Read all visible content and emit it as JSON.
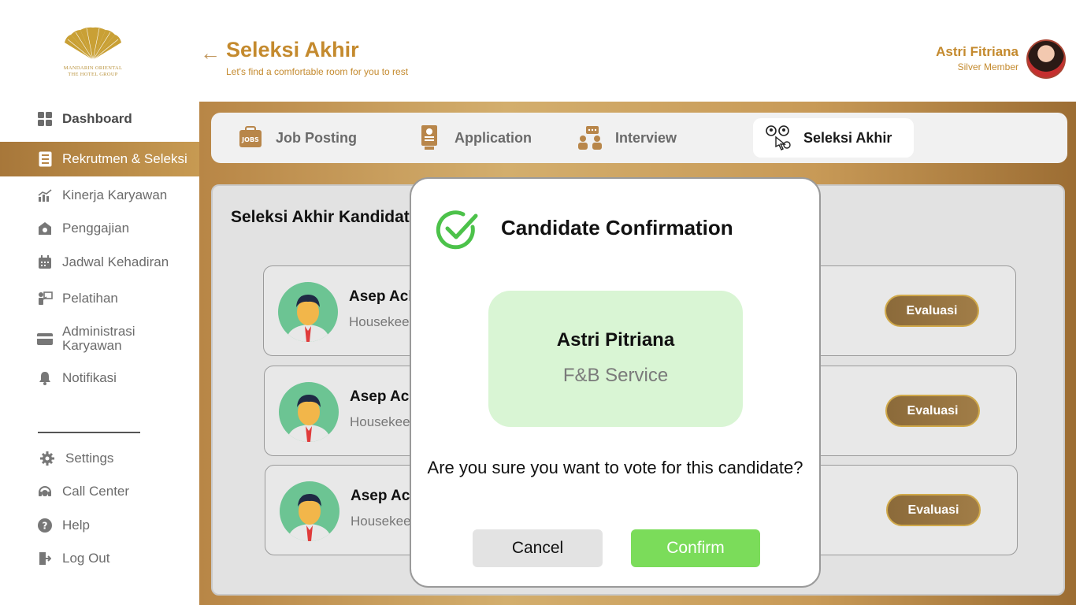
{
  "brand": {
    "logo_line1": "MANDARIN ORIENTAL",
    "logo_line2": "THE HOTEL GROUP"
  },
  "sidebar": {
    "items": [
      {
        "label": "Dashboard",
        "icon": "dashboard-icon"
      },
      {
        "label": "Rekrutmen & Seleksi",
        "icon": "document-list-icon",
        "active": true
      },
      {
        "label": "Kinerja Karyawan",
        "icon": "performance-chart-icon"
      },
      {
        "label": "Penggajian",
        "icon": "payroll-icon"
      },
      {
        "label": "Jadwal Kehadiran",
        "icon": "calendar-icon"
      },
      {
        "label": "Pelatihan",
        "icon": "training-icon"
      },
      {
        "label": "Administrasi Karyawan",
        "icon": "card-icon"
      },
      {
        "label": "Notifikasi",
        "icon": "bell-icon"
      }
    ],
    "bottom_items": [
      {
        "label": "Settings",
        "icon": "gear-icon"
      },
      {
        "label": "Call Center",
        "icon": "headset-icon"
      },
      {
        "label": "Help",
        "icon": "help-icon"
      },
      {
        "label": "Log Out",
        "icon": "logout-icon"
      }
    ]
  },
  "header": {
    "title": "Seleksi Akhir",
    "subtitle": "Let's find a comfortable room for you to rest",
    "user_name": "Astri Fitriana",
    "user_level": "Silver Member"
  },
  "tabs": [
    {
      "label": "Job Posting",
      "icon": "jobs-icon"
    },
    {
      "label": "Application",
      "icon": "application-icon"
    },
    {
      "label": "Interview",
      "icon": "interview-icon"
    },
    {
      "label": "Seleksi Akhir",
      "icon": "selection-icon",
      "active": true
    }
  ],
  "content": {
    "title": "Seleksi Akhir Kandidat",
    "candidates": [
      {
        "name": "Asep Achmad",
        "role": "Housekeeping",
        "action": "Evaluasi"
      },
      {
        "name": "Asep Achmad",
        "role": "Housekeeping",
        "action": "Evaluasi"
      },
      {
        "name": "Asep Achmad",
        "role": "Housekeeping",
        "action": "Evaluasi"
      }
    ]
  },
  "modal": {
    "title": "Candidate Confirmation",
    "candidate_name": "Astri Pitriana",
    "candidate_role": "F&B Service",
    "question": "Are you sure you want to vote for this candidate?",
    "cancel_label": "Cancel",
    "confirm_label": "Confirm"
  },
  "colors": {
    "gold": "#c48a2e",
    "active_nav": "#b88646",
    "confirm": "#7bdc5a",
    "candidate_box": "#d9f5d4"
  }
}
